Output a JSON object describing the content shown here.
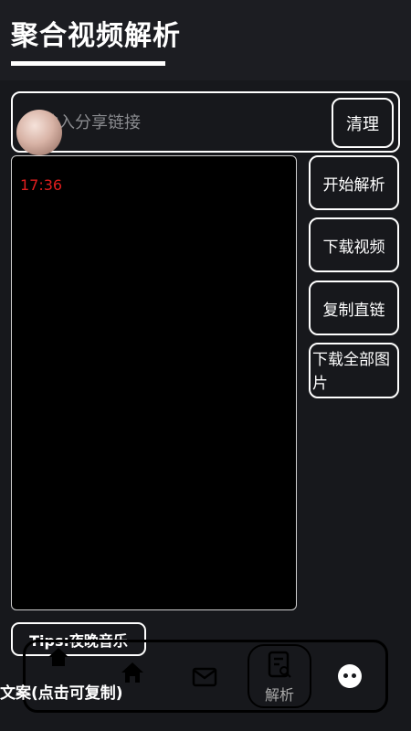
{
  "header": {
    "title": "聚合视频解析"
  },
  "input": {
    "placeholder": "输入分享链接",
    "value": ""
  },
  "buttons": {
    "clear": "清理",
    "parse": "开始解析",
    "download_video": "下载视频",
    "copy_link": "复制直链",
    "download_images": "下载全部图片"
  },
  "video": {
    "time": "17:36"
  },
  "tips": {
    "label": "Tips:夜晚音乐"
  },
  "copy_text": {
    "label": "文案(点击可复制)"
  },
  "nav": {
    "parse_label": "解析"
  },
  "colors": {
    "background": "#17181c",
    "time_red": "#e01e1e",
    "border": "#ffffff"
  }
}
